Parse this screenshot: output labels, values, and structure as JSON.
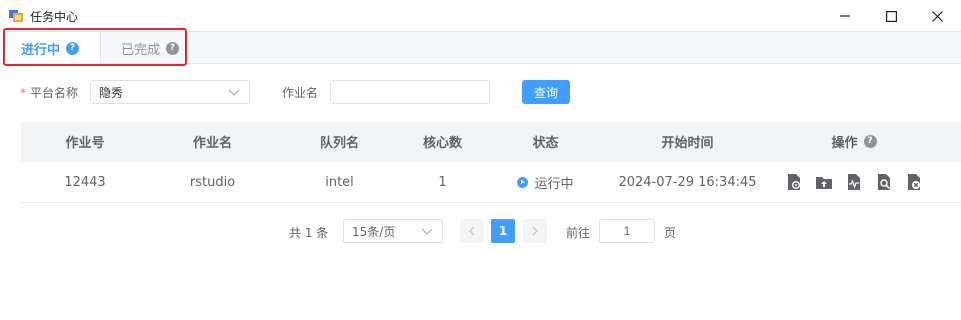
{
  "window": {
    "title": "任务中心"
  },
  "tabs": [
    {
      "label": "进行中",
      "active": true
    },
    {
      "label": "已完成",
      "active": false
    }
  ],
  "filters": {
    "platform_label": "平台名称",
    "platform_value": "隐秀",
    "job_name_label": "作业名",
    "job_name_value": "",
    "query_button": "查询"
  },
  "table": {
    "columns": [
      "作业号",
      "作业名",
      "队列名",
      "核心数",
      "状态",
      "开始时间",
      "操作"
    ],
    "rows": [
      {
        "job_id": "12443",
        "job_name": "rstudio",
        "queue": "intel",
        "cores": "1",
        "status": "运行中",
        "start_time": "2024-07-29 16:34:45"
      }
    ],
    "row_actions": [
      "settings-doc-icon",
      "upload-folder-icon",
      "monitor-doc-icon",
      "search-doc-icon",
      "cancel-doc-icon"
    ]
  },
  "pagination": {
    "total_text": "共 1 条",
    "page_size": "15条/页",
    "current_page": "1",
    "goto_label": "前往",
    "goto_value": "1",
    "page_unit": "页"
  },
  "colors": {
    "accent": "#409eff",
    "highlight_border": "#e5262c",
    "header_bg": "#f2f3f5"
  }
}
